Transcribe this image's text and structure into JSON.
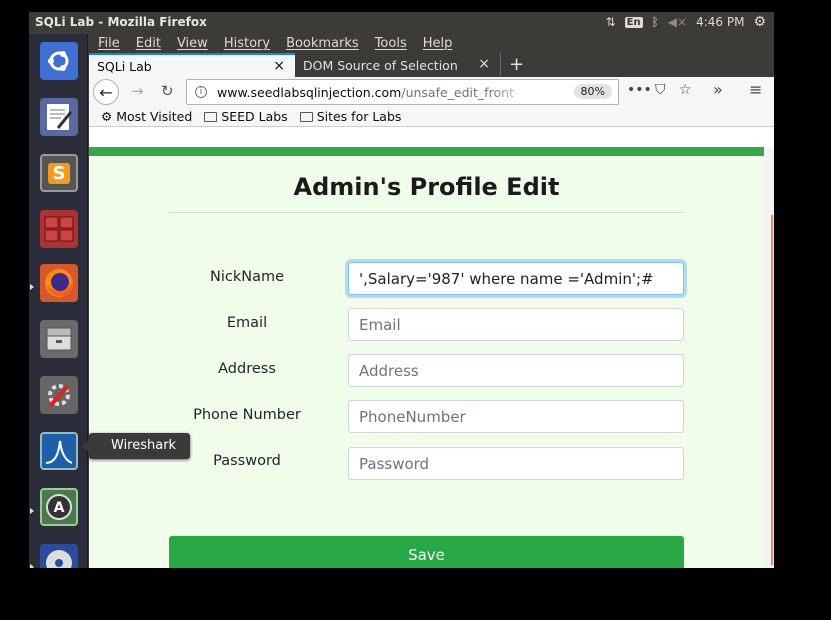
{
  "topbar": {
    "window_title": "SQLi Lab - Mozilla Firefox",
    "keyboard_layout": "En",
    "clock": "4:46 PM"
  },
  "launcher": {
    "tooltip": "Wireshark",
    "items": [
      "ubuntu-dash",
      "text-editor",
      "sublime-text",
      "workspace-switcher",
      "firefox",
      "file-manager",
      "system-settings",
      "wireshark",
      "software-updater",
      "dvd-drive"
    ]
  },
  "browser": {
    "menu": [
      "File",
      "Edit",
      "View",
      "History",
      "Bookmarks",
      "Tools",
      "Help"
    ],
    "tabs": [
      {
        "label": "SQLi Lab",
        "active": true
      },
      {
        "label": "DOM Source of Selection",
        "active": false
      }
    ],
    "url_host": "www.seedlabsqlinjection.com",
    "url_path": "/unsafe_edit_front",
    "zoom": "80%",
    "bookmarks": [
      "Most Visited",
      "SEED Labs",
      "Sites for Labs"
    ]
  },
  "page": {
    "title": "Admin's Profile Edit",
    "fields": [
      {
        "label": "NickName",
        "value": "',Salary='987' where name ='Admin';#",
        "placeholder": ""
      },
      {
        "label": "Email",
        "value": "",
        "placeholder": "Email"
      },
      {
        "label": "Address",
        "value": "",
        "placeholder": "Address"
      },
      {
        "label": "Phone Number",
        "value": "",
        "placeholder": "PhoneNumber"
      },
      {
        "label": "Password",
        "value": "",
        "placeholder": "Password"
      }
    ],
    "save_label": "Save",
    "colors": {
      "header_bar": "#3aa64a",
      "background": "#f0fdeb",
      "button": "#28a745"
    }
  }
}
